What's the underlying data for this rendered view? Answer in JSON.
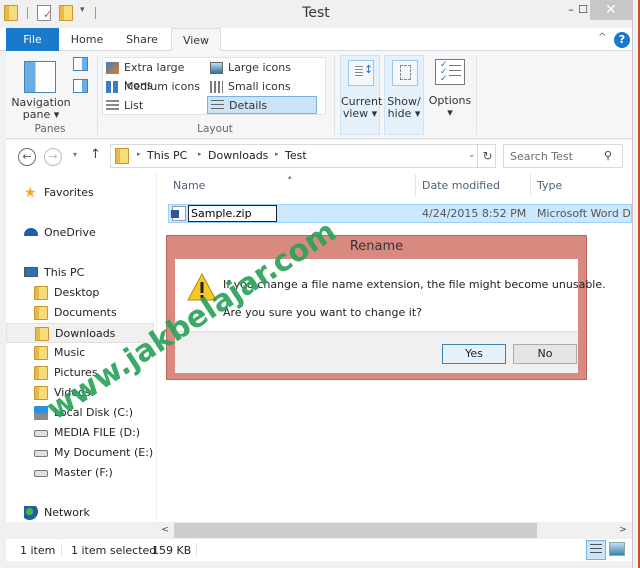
{
  "window": {
    "title": "Test",
    "controls": {
      "minimize": "–",
      "maximize": "☐",
      "close": "✕"
    }
  },
  "quick_access": {
    "icons": [
      "folder-icon",
      "properties-icon",
      "new-folder-icon",
      "customize-dropdown-icon"
    ],
    "dropdown_glyph": "▾"
  },
  "ribbon": {
    "tabs": [
      {
        "label": "File",
        "active": false
      },
      {
        "label": "Home",
        "active": false
      },
      {
        "label": "Share",
        "active": false
      },
      {
        "label": "View",
        "active": true
      }
    ],
    "collapse_glyph": "^",
    "help_glyph": "?",
    "groups": {
      "panes": {
        "label": "Panes",
        "navigation_pane_label": "Navigation pane ▾"
      },
      "layout": {
        "label": "Layout",
        "items": [
          {
            "label": "Extra large icons",
            "selected": false
          },
          {
            "label": "Large icons",
            "selected": false
          },
          {
            "label": "Medium icons",
            "selected": false
          },
          {
            "label": "Small icons",
            "selected": false
          },
          {
            "label": "List",
            "selected": false
          },
          {
            "label": "Details",
            "selected": true
          }
        ],
        "scroll_up": "▴",
        "scroll_down": "▾",
        "more": "⩡"
      },
      "current_view": {
        "label": "Current view ▾"
      },
      "show_hide": {
        "label": "Show/ hide ▾"
      },
      "options": {
        "label": "Options ▾"
      }
    }
  },
  "address_bar": {
    "back_glyph": "←",
    "forward_glyph": "→",
    "recent_glyph": "▾",
    "up_glyph": "↑",
    "breadcrumbs": [
      "This PC",
      "Downloads",
      "Test"
    ],
    "separator_glyph": "▸",
    "dropdown_glyph": "⌄",
    "refresh_glyph": "↻"
  },
  "search": {
    "placeholder": "Search Test",
    "icon_glyph": "⚲"
  },
  "nav_pane": {
    "items": [
      {
        "label": "Favorites",
        "icon": "star-icon",
        "indent": 0,
        "selected": false
      },
      {
        "label": "OneDrive",
        "icon": "cloud-icon",
        "indent": 0,
        "selected": false
      },
      {
        "label": "This PC",
        "icon": "computer-icon",
        "indent": 0,
        "selected": false
      },
      {
        "label": "Desktop",
        "icon": "folder-icon",
        "indent": 1,
        "selected": false
      },
      {
        "label": "Documents",
        "icon": "folder-icon",
        "indent": 1,
        "selected": false
      },
      {
        "label": "Downloads",
        "icon": "folder-icon",
        "indent": 1,
        "selected": true
      },
      {
        "label": "Music",
        "icon": "folder-icon",
        "indent": 1,
        "selected": false
      },
      {
        "label": "Pictures",
        "icon": "folder-icon",
        "indent": 1,
        "selected": false
      },
      {
        "label": "Videos",
        "icon": "folder-icon",
        "indent": 1,
        "selected": false
      },
      {
        "label": "Local Disk (C:)",
        "icon": "windows-drive-icon",
        "indent": 1,
        "selected": false
      },
      {
        "label": "MEDIA FILE (D:)",
        "icon": "drive-icon",
        "indent": 1,
        "selected": false
      },
      {
        "label": "My Document (E:)",
        "icon": "drive-icon",
        "indent": 1,
        "selected": false
      },
      {
        "label": "Master (F:)",
        "icon": "drive-icon",
        "indent": 1,
        "selected": false
      },
      {
        "label": "Network",
        "icon": "network-icon",
        "indent": 0,
        "selected": false
      }
    ]
  },
  "file_list": {
    "columns": [
      "Name",
      "Date modified",
      "Type"
    ],
    "sort_glyph": "▴",
    "rows": [
      {
        "name": "Sample.zip",
        "date_modified": "4/24/2015 8:52 PM",
        "type": "Microsoft Word D...",
        "selected": true,
        "renaming": true
      }
    ]
  },
  "scrollbar": {
    "left_glyph": "<",
    "right_glyph": ">"
  },
  "status_bar": {
    "item_count": "1 item",
    "selection": "1 item selected",
    "size": "159 KB"
  },
  "dialog": {
    "title": "Rename",
    "message": "If you change a file name extension, the file might become unusable.",
    "question": "Are you sure you want to change it?",
    "yes_label": "Yes",
    "no_label": "No",
    "warning_glyph": "!"
  },
  "watermark": {
    "text": "www.jakbelajar.com",
    "color": "#2aa35a"
  },
  "colors": {
    "accent": "#1979ca",
    "selection": "#cce8ff",
    "dialog_frame": "#d98a80"
  }
}
